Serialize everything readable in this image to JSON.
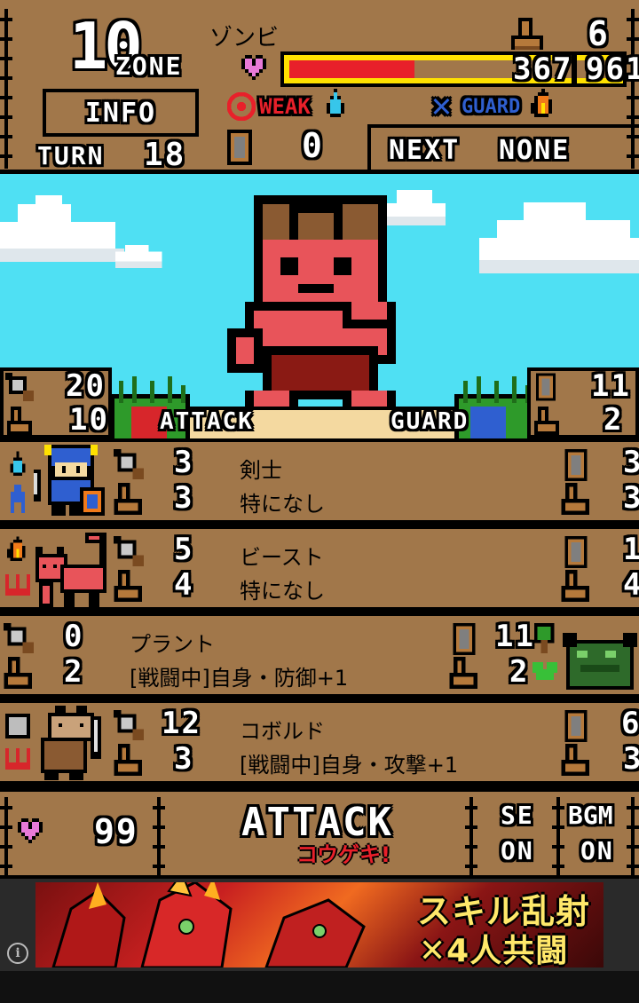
{
  "top": {
    "zone_number": "10",
    "zone_label": "ZONE",
    "info_label": "INFO",
    "turn_label": "TURN",
    "turn_value": "18",
    "enemy_name": "ゾンビ",
    "enemy_speed": "6",
    "hp_current": "367",
    "hp_max": "961",
    "hp_fraction": 0.38,
    "weak_label": "WEAK",
    "guard_label": "GUARD",
    "shield_count": "0",
    "next_label": "NEXT",
    "next_value": "NONE"
  },
  "battle": {
    "left_attack": "20",
    "left_speed": "10",
    "attack_label": "ATTACK",
    "guard_label": "GUARD",
    "right_guard": "11",
    "right_speed": "2"
  },
  "party": [
    {
      "name": "剣士",
      "skill": "特になし",
      "atk": "3",
      "spd": "3",
      "def": "3",
      "def_spd": "3",
      "element": "water"
    },
    {
      "name": "ビースト",
      "skill": "特になし",
      "atk": "5",
      "spd": "4",
      "def": "1",
      "def_spd": "4",
      "element": "fire"
    },
    {
      "name": "プラント",
      "skill": "[戦闘中]自身・防御+1",
      "atk": "0",
      "spd": "2",
      "def": "11",
      "def_spd": "2",
      "element": "wood"
    },
    {
      "name": "コボルド",
      "skill": "[戦闘中]自身・攻撃+1",
      "atk": "12",
      "spd": "3",
      "def": "6",
      "def_spd": "3",
      "element": "none"
    }
  ],
  "bottom": {
    "life": "99",
    "attack_button": "ATTACK",
    "attack_sub": "コウゲキ!",
    "se_label": "SE",
    "se_value": "ON",
    "bgm_label": "BGM",
    "bgm_value": "ON"
  },
  "ad": {
    "line1": "スキル乱射",
    "line2": "✕4人共闘",
    "info_icon": "i"
  },
  "colors": {
    "wood": "#a1774a",
    "sky": "#4fe0f3",
    "hp_red": "#e8202a",
    "hp_yellow": "#ffe100",
    "attack_red": "#d7262b",
    "guard_blue": "#2f5fd0",
    "heart": "#e87ad8"
  }
}
